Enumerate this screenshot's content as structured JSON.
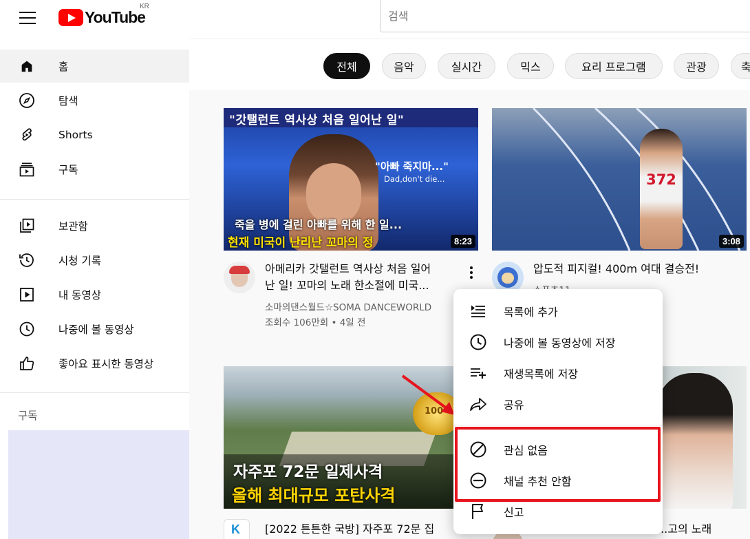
{
  "header": {
    "logo_text": "YouTube",
    "country": "KR",
    "search_placeholder": "검색"
  },
  "sidebar": {
    "items": [
      {
        "label": "홈",
        "icon": "home-icon"
      },
      {
        "label": "탐색",
        "icon": "compass-icon"
      },
      {
        "label": "Shorts",
        "icon": "shorts-icon"
      },
      {
        "label": "구독",
        "icon": "subscriptions-icon"
      },
      {
        "label": "보관함",
        "icon": "library-icon"
      },
      {
        "label": "시청 기록",
        "icon": "history-icon"
      },
      {
        "label": "내 동영상",
        "icon": "my-videos-icon"
      },
      {
        "label": "나중에 볼 동영상",
        "icon": "clock-icon"
      },
      {
        "label": "좋아요 표시한 동영상",
        "icon": "thumbs-up-icon"
      }
    ],
    "section_title": "구독"
  },
  "chips": [
    "전체",
    "음악",
    "실시간",
    "믹스",
    "요리 프로그램",
    "관광",
    "축"
  ],
  "videos": [
    {
      "thumb_top_text": "\"갓탤런트 역사상 처음 일어난 일\"",
      "thumb_quote": "\"아빠 죽지마...\"",
      "thumb_quote_en": "Dad,don't die...",
      "thumb_line1": "죽을 병에 걸린 아빠를 위해 한 일...",
      "thumb_line2": "현재 미국이 난리난 꼬마의 정",
      "duration": "8:23",
      "title_line1": "아메리카 갓탤런트 역사상 처음 일어",
      "title_line2": "난 일! 꼬마의 노래 한소절에 미국...",
      "channel": "소마의댄스월드☆SOMA DANCEWORLD",
      "stats": "조회수 106만회 • 4일 전"
    },
    {
      "bib": "372",
      "duration": "3:08",
      "title_line1": "압도적 피지컬! 400m 여대 결승전!",
      "channel": "스포츠11"
    },
    {
      "thumb_badge": "100",
      "thumb_line1": "자주포 72문 일제사격",
      "thumb_line2": "올해 최대규모 포탄사격",
      "title_line1": "[2022 튼튼한 국방] 자주포 72문 집",
      "avatar_letter": "K"
    },
    {
      "title_line1": "...고의 노래"
    }
  ],
  "menu": {
    "items": [
      {
        "label": "목록에 추가",
        "icon": "queue-icon"
      },
      {
        "label": "나중에 볼 동영상에 저장",
        "icon": "clock-icon"
      },
      {
        "label": "재생목록에 저장",
        "icon": "playlist-add-icon"
      },
      {
        "label": "공유",
        "icon": "share-icon"
      },
      {
        "label": "관심 없음",
        "icon": "not-interested-icon"
      },
      {
        "label": "채널 추천 안함",
        "icon": "block-channel-icon"
      },
      {
        "label": "신고",
        "icon": "flag-icon"
      }
    ]
  },
  "colors": {
    "brand_red": "#ff0000",
    "highlight_red": "#e8141d",
    "annotation_arrow": "#e8141d"
  }
}
